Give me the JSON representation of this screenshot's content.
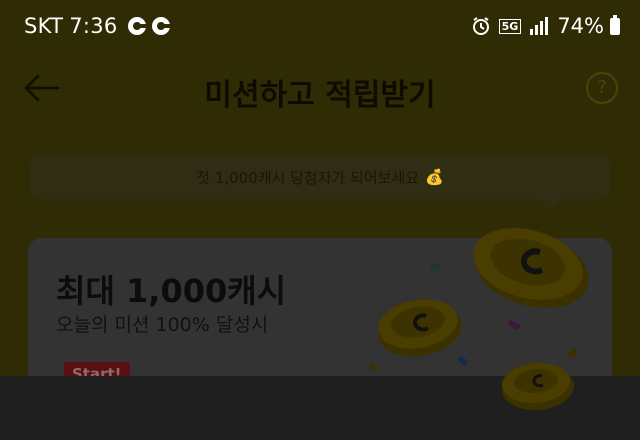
{
  "status_bar": {
    "carrier": "SKT",
    "time": "7:36",
    "network": "5G",
    "battery": "74%"
  },
  "header": {
    "title": "미션하고 적립받기",
    "help_label": "?"
  },
  "banner": {
    "text": "첫 1,000캐시 당첨자가 되어보세요"
  },
  "card": {
    "title": "최대 1,000캐시",
    "subtitle": "오늘의 미션 100% 달성시",
    "start_label": "Start!"
  },
  "colors": {
    "background": "#2e2b05",
    "card": "#333333",
    "accent": "#5a1010"
  }
}
